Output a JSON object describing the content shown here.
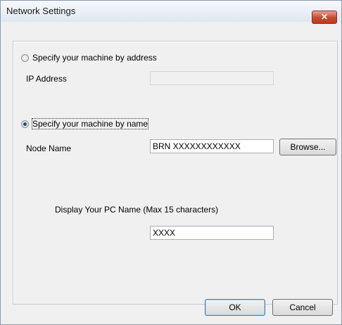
{
  "window": {
    "title": "Network Settings",
    "close_glyph": "✕"
  },
  "address_option": {
    "label": "Specify your machine by address",
    "checked": false,
    "ip_label": "IP Address",
    "ip_value": ""
  },
  "name_option": {
    "label": "Specify your machine by name",
    "checked": true,
    "node_label": "Node Name",
    "node_value": "BRN XXXXXXXXXXXX",
    "browse_label": "Browse..."
  },
  "pc_name": {
    "label": "Display Your PC Name (Max 15 characters)",
    "value": "XXXX"
  },
  "footer": {
    "ok_label": "OK",
    "cancel_label": "Cancel"
  },
  "colors": {
    "accent": "#3c7fb1",
    "close": "#c9482f"
  }
}
